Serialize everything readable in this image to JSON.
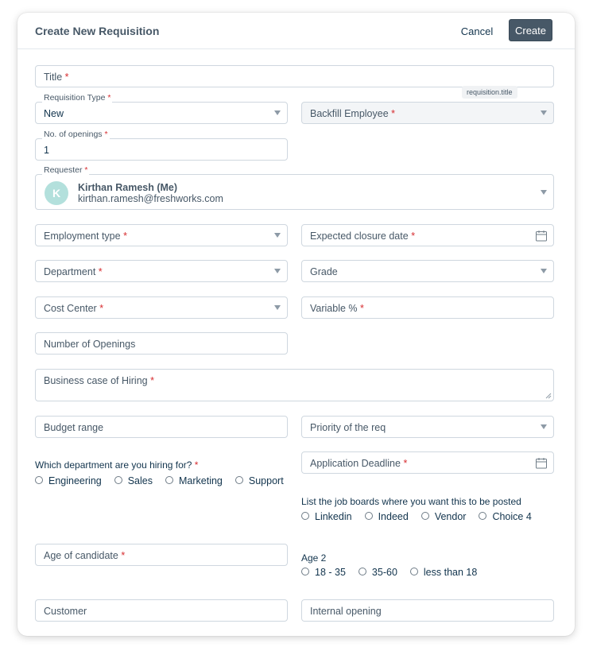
{
  "header": {
    "title": "Create New Requisition",
    "cancel_label": "Cancel",
    "create_label": "Create"
  },
  "tooltip": "requisition.title",
  "required_mark": "*",
  "fields": {
    "title": {
      "label": "Title"
    },
    "requisition_type": {
      "label": "Requisition Type",
      "value": "New"
    },
    "backfill_employee": {
      "label": "Backfill Employee"
    },
    "no_of_openings": {
      "label": "No. of openings",
      "value": "1"
    },
    "requester": {
      "label": "Requester",
      "avatar_initial": "K",
      "name": "Kirthan Ramesh (Me)",
      "email": "kirthan.ramesh@freshworks.com"
    },
    "employment_type": {
      "label": "Employment type"
    },
    "expected_closure_date": {
      "label": "Expected closure date"
    },
    "department": {
      "label": "Department"
    },
    "grade": {
      "label": "Grade"
    },
    "cost_center": {
      "label": "Cost Center"
    },
    "variable_pct": {
      "label": "Variable %"
    },
    "number_of_openings": {
      "label": "Number of Openings"
    },
    "business_case": {
      "label": "Business case of Hiring"
    },
    "budget_range": {
      "label": "Budget range"
    },
    "priority": {
      "label": "Priority of the req"
    },
    "application_deadline": {
      "label": "Application Deadline"
    },
    "age_of_candidate": {
      "label": "Age of candidate"
    },
    "customer": {
      "label": "Customer"
    },
    "internal_opening": {
      "label": "Internal opening"
    }
  },
  "questions": {
    "department": {
      "label": "Which department are you hiring for?",
      "options": [
        "Engineering",
        "Sales",
        "Marketing",
        "Support"
      ]
    },
    "job_boards": {
      "label": "List the job boards where you want this to be posted",
      "options": [
        "Linkedin",
        "Indeed",
        "Vendor",
        "Choice 4"
      ]
    },
    "age2": {
      "label": "Age 2",
      "options": [
        "18 - 35",
        "35-60",
        "less than 18"
      ]
    }
  },
  "colors": {
    "primary_button": "#475867",
    "required": "#d72d30",
    "border": "#cfd7df",
    "avatar": "#b3e0dc"
  }
}
